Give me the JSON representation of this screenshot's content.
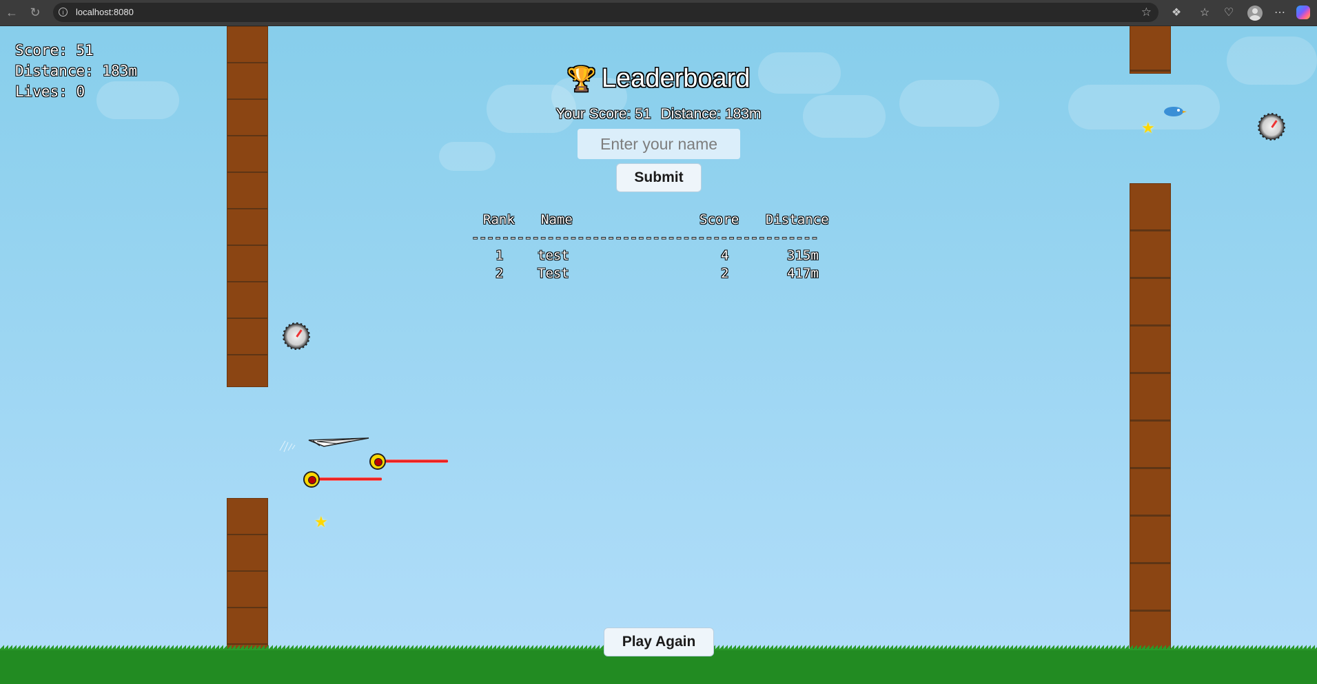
{
  "browser": {
    "url": "localhost:8080",
    "back_icon": "arrow-left-icon",
    "reload_icon": "reload-icon",
    "site_info_icon": "info-icon",
    "bookmark_icon": "star-outline-icon",
    "toolbar_icons": [
      "extensions-icon",
      "favorites-icon",
      "browser-essentials-icon",
      "profile-avatar-icon",
      "more-icon",
      "copilot-icon"
    ]
  },
  "hud": {
    "score": "Score: 51",
    "distance": "Distance: 183m",
    "lives": "Lives: 0"
  },
  "leaderboard": {
    "trophy_icon": "trophy-icon",
    "title": "Leaderboard",
    "your_score": "Your Score: 51",
    "your_distance": "Distance: 183m",
    "name_placeholder": "Enter your name",
    "name_value": "",
    "submit_label": "Submit",
    "columns": {
      "rank": "Rank",
      "name": "Name",
      "score": "Score",
      "distance": "Distance"
    },
    "separator": "----------------------------------------------",
    "rows": [
      {
        "rank": "1",
        "name": "test",
        "score": "4",
        "distance": "315m"
      },
      {
        "rank": "2",
        "name": "Test",
        "score": "2",
        "distance": "417m"
      }
    ]
  },
  "play_again_label": "Play Again",
  "colors": {
    "sky_top": "#87ceeb",
    "pipe": "#8b4513",
    "ground": "#228b22",
    "laser": "#e00000",
    "star": "#ffd700"
  }
}
